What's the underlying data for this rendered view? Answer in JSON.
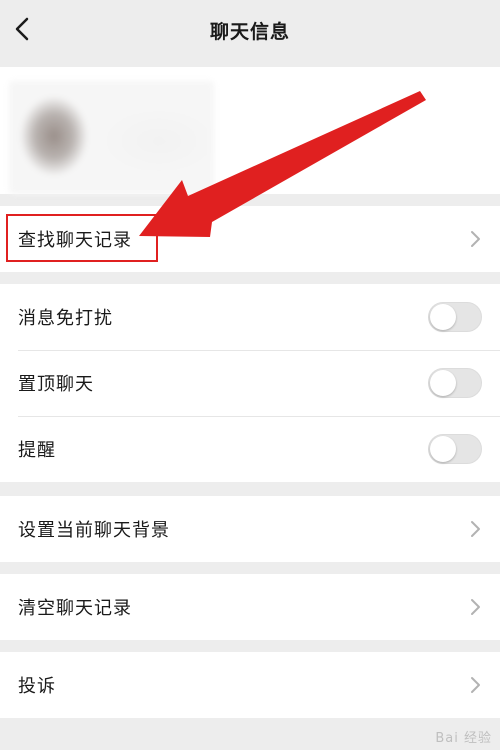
{
  "header": {
    "title": "聊天信息"
  },
  "groups": {
    "search": {
      "label": "查找聊天记录"
    },
    "toggles": [
      {
        "label": "消息免打扰",
        "on": false
      },
      {
        "label": "置顶聊天",
        "on": false
      },
      {
        "label": "提醒",
        "on": false
      }
    ],
    "background": {
      "label": "设置当前聊天背景"
    },
    "clear": {
      "label": "清空聊天记录"
    },
    "report": {
      "label": "投诉"
    }
  },
  "annotation": {
    "color": "#e02020"
  },
  "watermark": {
    "text": "Bai 经验"
  }
}
